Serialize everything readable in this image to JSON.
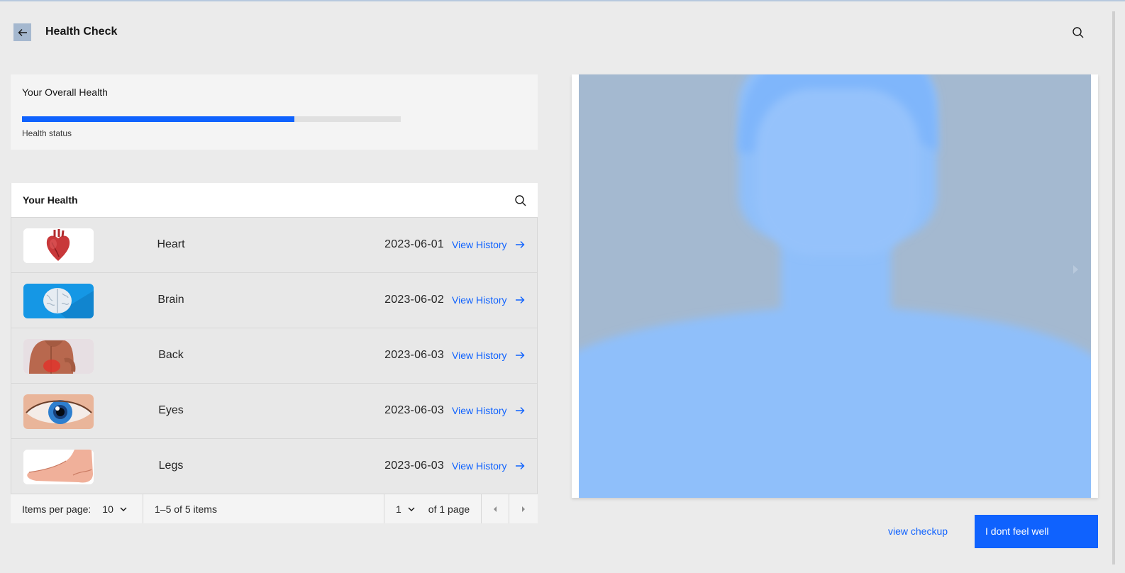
{
  "header": {
    "title": "Health Check",
    "back_icon": "arrow-left-icon",
    "search_icon": "search-icon"
  },
  "overall": {
    "title": "Your Overall Health",
    "progress_percent": 72,
    "status_label": "Health status"
  },
  "table": {
    "title": "Your Health",
    "rows": [
      {
        "name": "Heart",
        "date": "2023-06-01",
        "link": "View History",
        "image": "heart-image"
      },
      {
        "name": "Brain",
        "date": "2023-06-02",
        "link": "View History",
        "image": "brain-image"
      },
      {
        "name": "Back",
        "date": "2023-06-03",
        "link": "View History",
        "image": "back-image"
      },
      {
        "name": "Eyes",
        "date": "2023-06-03",
        "link": "View History",
        "image": "eye-image"
      },
      {
        "name": "Legs",
        "date": "2023-06-03",
        "link": "View History",
        "image": "foot-image"
      }
    ]
  },
  "pagination": {
    "items_per_page_label": "Items per page:",
    "items_per_page_value": "10",
    "range_text": "1–5 of 5 items",
    "page_value": "1",
    "page_total_text": "of 1 page"
  },
  "panel": {
    "secondary_action": "view checkup",
    "primary_action": "I dont feel well"
  },
  "colors": {
    "accent": "#0f62fe",
    "background": "#ebebeb",
    "avatar_fill": "#8fbffa",
    "avatar_bg": "#a4b9d0"
  }
}
